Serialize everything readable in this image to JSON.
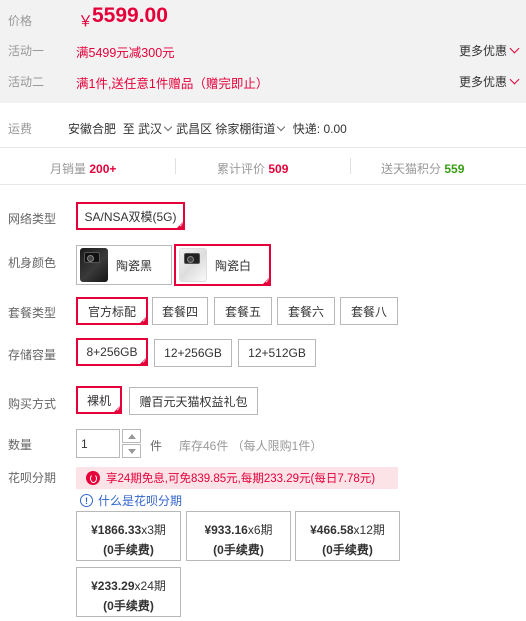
{
  "price": {
    "label": "价格",
    "symbol": "￥",
    "value": "5599.00"
  },
  "promos": [
    {
      "label": "活动一",
      "text": "满5499元减300元",
      "more": "更多优惠"
    },
    {
      "label": "活动二",
      "text": "满1件,送任意1件赠品（赠完即止）",
      "more": "更多优惠"
    }
  ],
  "shipping": {
    "label": "运费",
    "origin": "安徽合肥",
    "to": "至",
    "city": "武汉",
    "district": "武昌区",
    "street": "徐家棚街道",
    "express": "快递: 0.00"
  },
  "stats": {
    "monthly_label": "月销量",
    "monthly_value": "200+",
    "reviews_label": "累计评价",
    "reviews_value": "509",
    "points_label": "送天猫积分",
    "points_value": "559"
  },
  "network": {
    "label": "网络类型",
    "options": [
      "SA/NSA双模(5G)"
    ]
  },
  "color": {
    "label": "机身颜色",
    "options": [
      "陶瓷黑",
      "陶瓷白"
    ]
  },
  "package": {
    "label": "套餐类型",
    "options": [
      "官方标配",
      "套餐四",
      "套餐五",
      "套餐六",
      "套餐八"
    ]
  },
  "storage": {
    "label": "存储容量",
    "options": [
      "8+256GB",
      "12+256GB",
      "12+512GB"
    ]
  },
  "purchase": {
    "label": "购买方式",
    "options": [
      "裸机",
      "赠百元天猫权益礼包"
    ]
  },
  "quantity": {
    "label": "数量",
    "value": "1",
    "unit": "件",
    "stock": "库存46件 （每人限购1件）"
  },
  "huabei": {
    "label": "花呗分期",
    "banner": "享24期免息,可免839.85元,每期233.29元(每日7.78元)",
    "info": "什么是花呗分期",
    "plans": [
      {
        "amount": "¥1866.33",
        "period": "x3期",
        "fee": "(0手续费)"
      },
      {
        "amount": "¥933.16",
        "period": "x6期",
        "fee": "(0手续费)"
      },
      {
        "amount": "¥466.58",
        "period": "x12期",
        "fee": "(0手续费)"
      },
      {
        "amount": "¥233.29",
        "period": "x24期",
        "fee": "(0手续费)"
      }
    ]
  },
  "colors": {
    "accent": "#e5003a",
    "green": "#3a9c13",
    "link": "#3366cc"
  }
}
